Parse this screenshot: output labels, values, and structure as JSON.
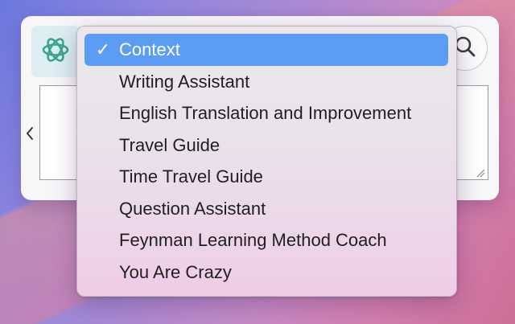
{
  "menu": {
    "items": [
      {
        "label": "Context",
        "checkmark": "✓"
      },
      {
        "label": "Writing Assistant"
      },
      {
        "label": "English Translation and Improvement"
      },
      {
        "label": "Travel Guide"
      },
      {
        "label": "Time Travel Guide"
      },
      {
        "label": "Question Assistant"
      },
      {
        "label": "Feynman Learning Method Coach"
      },
      {
        "label": "You Are Crazy"
      }
    ],
    "selected_index": 0
  },
  "icons": {
    "logo": "chatgpt-logo-icon",
    "search": "search-icon",
    "back": "chevron-left-icon",
    "resize": "resize-grip-icon"
  },
  "colors": {
    "selection": "#5b9df5",
    "logo": "#3aa491",
    "logo_background": "#ddeef3"
  }
}
